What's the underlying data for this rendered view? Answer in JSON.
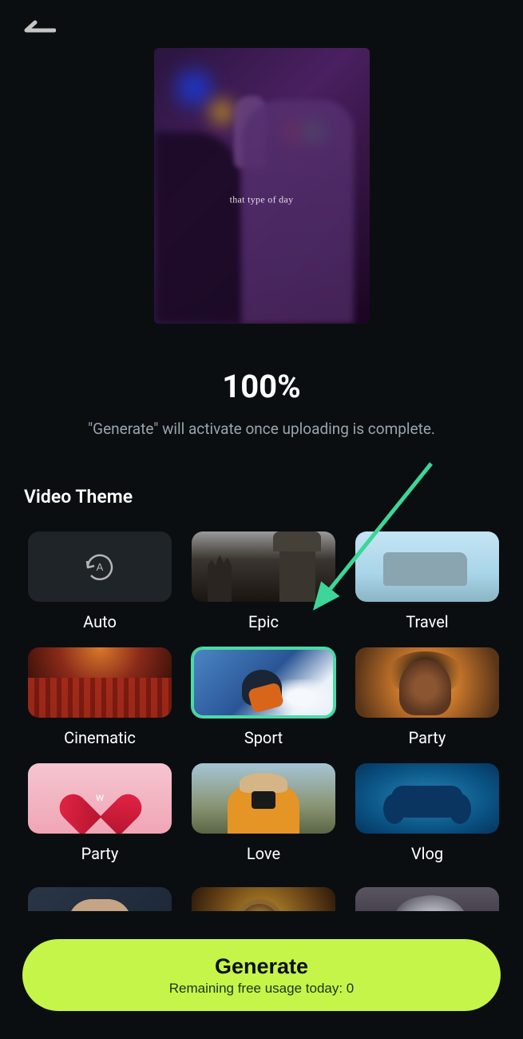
{
  "preview": {
    "caption": "that type of day"
  },
  "progress": {
    "percent": "100%",
    "hint": "\"Generate\" will activate once uploading is complete."
  },
  "section": {
    "title": "Video Theme"
  },
  "themes": [
    {
      "label": "Auto",
      "selected": false
    },
    {
      "label": "Epic",
      "selected": false
    },
    {
      "label": "Travel",
      "selected": false
    },
    {
      "label": "Cinematic",
      "selected": false
    },
    {
      "label": "Sport",
      "selected": true
    },
    {
      "label": "Party",
      "selected": false
    },
    {
      "label": "Party",
      "selected": false
    },
    {
      "label": "Love",
      "selected": false
    },
    {
      "label": "Vlog",
      "selected": false
    }
  ],
  "heart_letter": "w",
  "generate": {
    "label": "Generate",
    "sub": "Remaining free usage today: 0"
  }
}
